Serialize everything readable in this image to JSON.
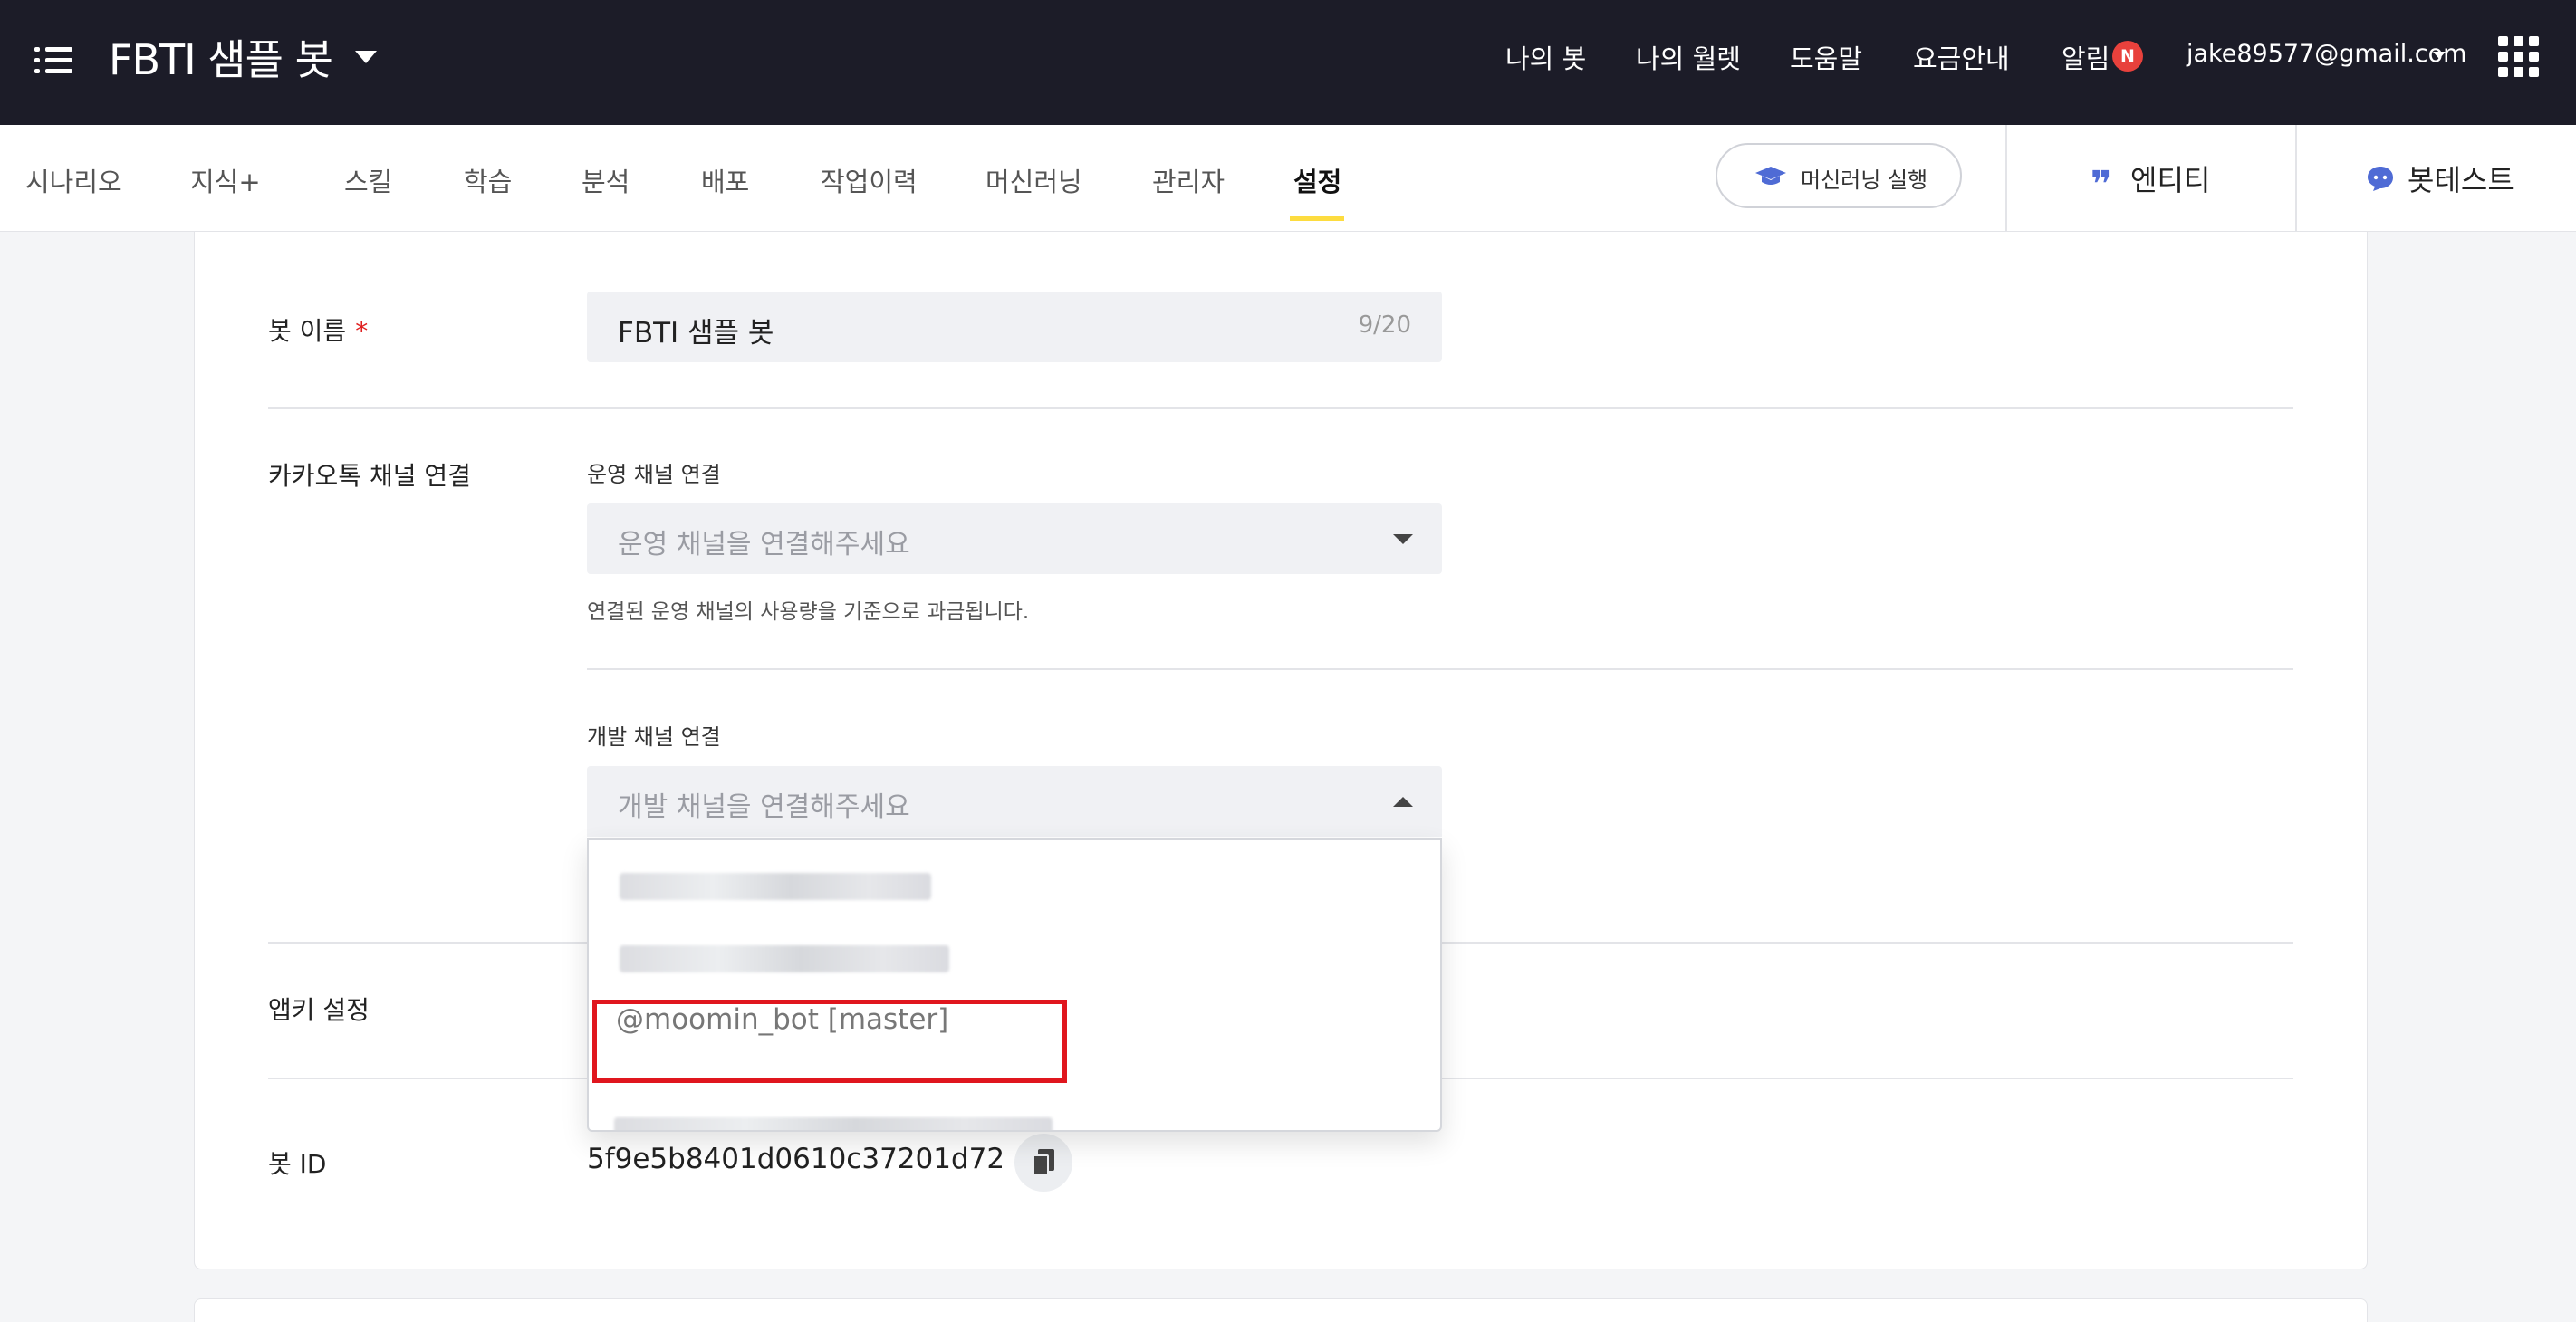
{
  "app": {
    "title": "FBTI 샘플 봇"
  },
  "top_nav": {
    "items": [
      "나의 봇",
      "나의 월렛",
      "도움말",
      "요금안내",
      "알림"
    ],
    "notification_badge": "N",
    "account_email": "jake89577@gmail.com"
  },
  "tabs": {
    "items": [
      "시나리오",
      "지식+",
      "스킬",
      "학습",
      "분석",
      "배포",
      "작업이력",
      "머신러닝",
      "관리자",
      "설정"
    ],
    "active": "설정"
  },
  "tools": {
    "ml_button": "머신러닝 실행",
    "entity": "엔티티",
    "bot_test": "봇테스트"
  },
  "form": {
    "bot_name": {
      "label": "봇 이름",
      "required_mark": "*",
      "value": "FBTI 샘플 봇",
      "count": "9/20"
    },
    "kakao": {
      "label": "카카오톡 채널 연결",
      "operation": {
        "label": "운영 채널 연결",
        "placeholder": "운영 채널을 연결해주세요",
        "helper": "연결된 운영 채널의 사용량을 기준으로 과금됩니다."
      },
      "development": {
        "label": "개발 채널 연결",
        "placeholder": "개발 채널을 연결해주세요",
        "options": [
          "@moomin_bot [master]"
        ]
      }
    },
    "appkey": {
      "label": "앱키 설정"
    },
    "bot_id": {
      "label": "봇 ID",
      "value": "5f9e5b8401d0610c37201d72"
    }
  },
  "colors": {
    "topbar": "#1c1c28",
    "accent_underline": "#fddc3f",
    "badge": "#e8413c",
    "highlight": "#e0161e",
    "icon_blue": "#4f6bd5"
  },
  "icons": {
    "menu": "menu-icon",
    "apps": "apps-grid-icon",
    "ml": "graduation-cap-icon",
    "entity": "quote-icon",
    "bot_test": "chat-bubble-icon",
    "copy": "copy-icon"
  }
}
